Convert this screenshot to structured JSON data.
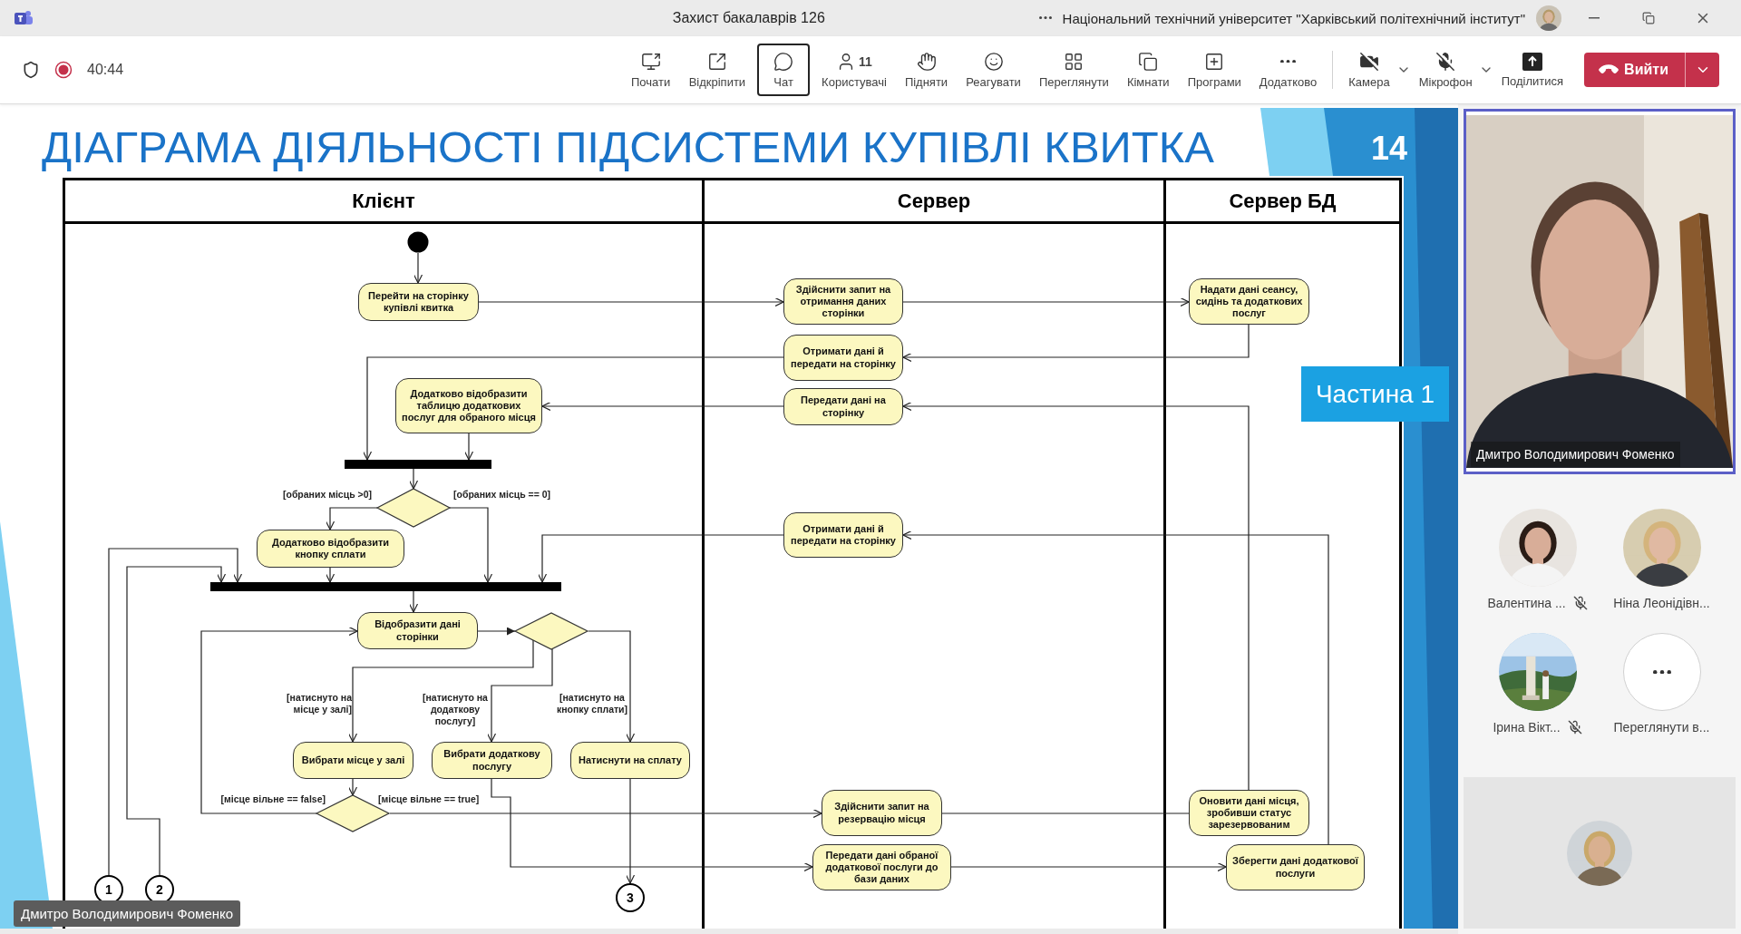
{
  "window": {
    "title": "Захист бакалаврів 126",
    "organization": "Національний технічний університет \"Харківський політехнічний інститут\""
  },
  "meeting": {
    "elapsed": "40:44",
    "recording": true
  },
  "toolbar": {
    "buttons": [
      {
        "kind": "present",
        "label": "Почати",
        "selected": false
      },
      {
        "kind": "pop-out",
        "label": "Відкріпити",
        "selected": false
      },
      {
        "kind": "chat",
        "label": "Чат",
        "selected": true
      },
      {
        "kind": "people",
        "label": "Користувачі",
        "count": "11",
        "selected": false
      },
      {
        "kind": "hand",
        "label": "Підняти",
        "selected": false
      },
      {
        "kind": "react",
        "label": "Реагувати",
        "selected": false
      },
      {
        "kind": "view",
        "label": "Переглянути",
        "selected": false
      },
      {
        "kind": "rooms",
        "label": "Кімнати",
        "selected": false
      },
      {
        "kind": "apps",
        "label": "Програми",
        "selected": false
      },
      {
        "kind": "more",
        "label": "Додатково",
        "selected": false
      }
    ],
    "devices": [
      {
        "kind": "camera",
        "label": "Камера",
        "on": false
      },
      {
        "kind": "mic",
        "label": "Мікрофон",
        "on": false
      }
    ],
    "share": {
      "label": "Поділитися"
    },
    "leave": {
      "label": "Вийти"
    }
  },
  "slide": {
    "title": "ДІАГРАМА ДІЯЛЬНОСТІ ПІДСИСТЕМИ КУПІВЛІ КВИТКА",
    "number": "14",
    "badge": "Частина 1",
    "diagram": {
      "lanes": [
        "Клієнт",
        "Сервер",
        "Сервер БД"
      ],
      "actions": [
        "Перейти на сторінку купівлі квитка",
        "Здійснити запит на отримання даних сторінки",
        "Надати дані сеансу, сидінь та додаткових послуг",
        "Отримати дані й передати на сторінку",
        "Додатково відобразити таблицю додаткових послуг для обраного місця",
        "Передати дані на сторінку",
        "Додатково відобразити кнопку сплати",
        "Отримати дані й передати на сторінку",
        "Відобразити дані сторінки",
        "Вибрати місце у залі",
        "Вибрати додаткову послугу",
        "Натиснути на сплату",
        "Здійснити запит на резервацію місця",
        "Оновити дані місця, зробивши статус зарезервованим",
        "Передати дані обраної додаткової послуги до бази даних",
        "Зберегти дані додаткової послуги"
      ],
      "guards": [
        "[обраних місць >0]",
        "[обраних місць == 0]",
        "[натиснуто на місце у залі]",
        "[натиснуто на додаткову послугу]",
        "[натиснуто на кнопку сплати]",
        "[місце вільне == false]",
        "[місце вільне == true]"
      ],
      "connectors": [
        "1",
        "2",
        "3"
      ]
    }
  },
  "presenter_label": "Дмитро Володимирович Фоменко",
  "participants": {
    "featured": {
      "name": "Дмитро Володимирович Фоменко"
    },
    "people": [
      {
        "kind": "person",
        "name": "Валентина ...",
        "muted": true
      },
      {
        "kind": "person",
        "name": "Ніна Леонідівн...",
        "muted": false
      },
      {
        "kind": "person",
        "name": "Ірина Вікт...",
        "muted": true
      },
      {
        "kind": "more",
        "name": "Переглянути в...",
        "muted": false
      }
    ]
  }
}
